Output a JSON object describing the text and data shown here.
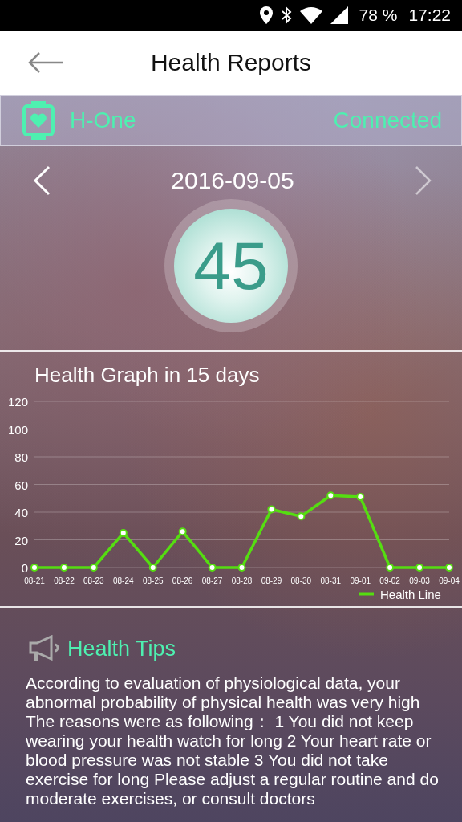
{
  "status_bar": {
    "battery": "78 %",
    "time": "17:22"
  },
  "header": {
    "title": "Health Reports"
  },
  "device": {
    "name": "H-One",
    "status": "Connected"
  },
  "report": {
    "date": "2016-09-05",
    "score": "45"
  },
  "graph": {
    "title": "Health Graph in 15 days",
    "chart_data": {
      "type": "line",
      "categories": [
        "08-21",
        "08-22",
        "08-23",
        "08-24",
        "08-25",
        "08-26",
        "08-27",
        "08-28",
        "08-29",
        "08-30",
        "08-31",
        "09-01",
        "09-02",
        "09-03",
        "09-04"
      ],
      "grid": true,
      "series": [
        {
          "name": "Health Line",
          "color": "#55dd11",
          "marker": "circle",
          "values": [
            0,
            0,
            0,
            25,
            0,
            26,
            0,
            0,
            42,
            37,
            52,
            51,
            0,
            0,
            0
          ]
        }
      ],
      "ylim": [
        0,
        120
      ],
      "yticks": [
        0,
        20,
        40,
        60,
        80,
        100,
        120
      ]
    }
  },
  "tips": {
    "title": "Health Tips",
    "text": "According to evaluation of physiological data, your abnormal probability of physical health was very high The reasons were as following：  1 You did not keep wearing your health watch for long 2 Your heart rate or blood pressure was not stable 3 You did not take exercise for long Please adjust a regular routine and do moderate exercises, or consult doctors"
  }
}
